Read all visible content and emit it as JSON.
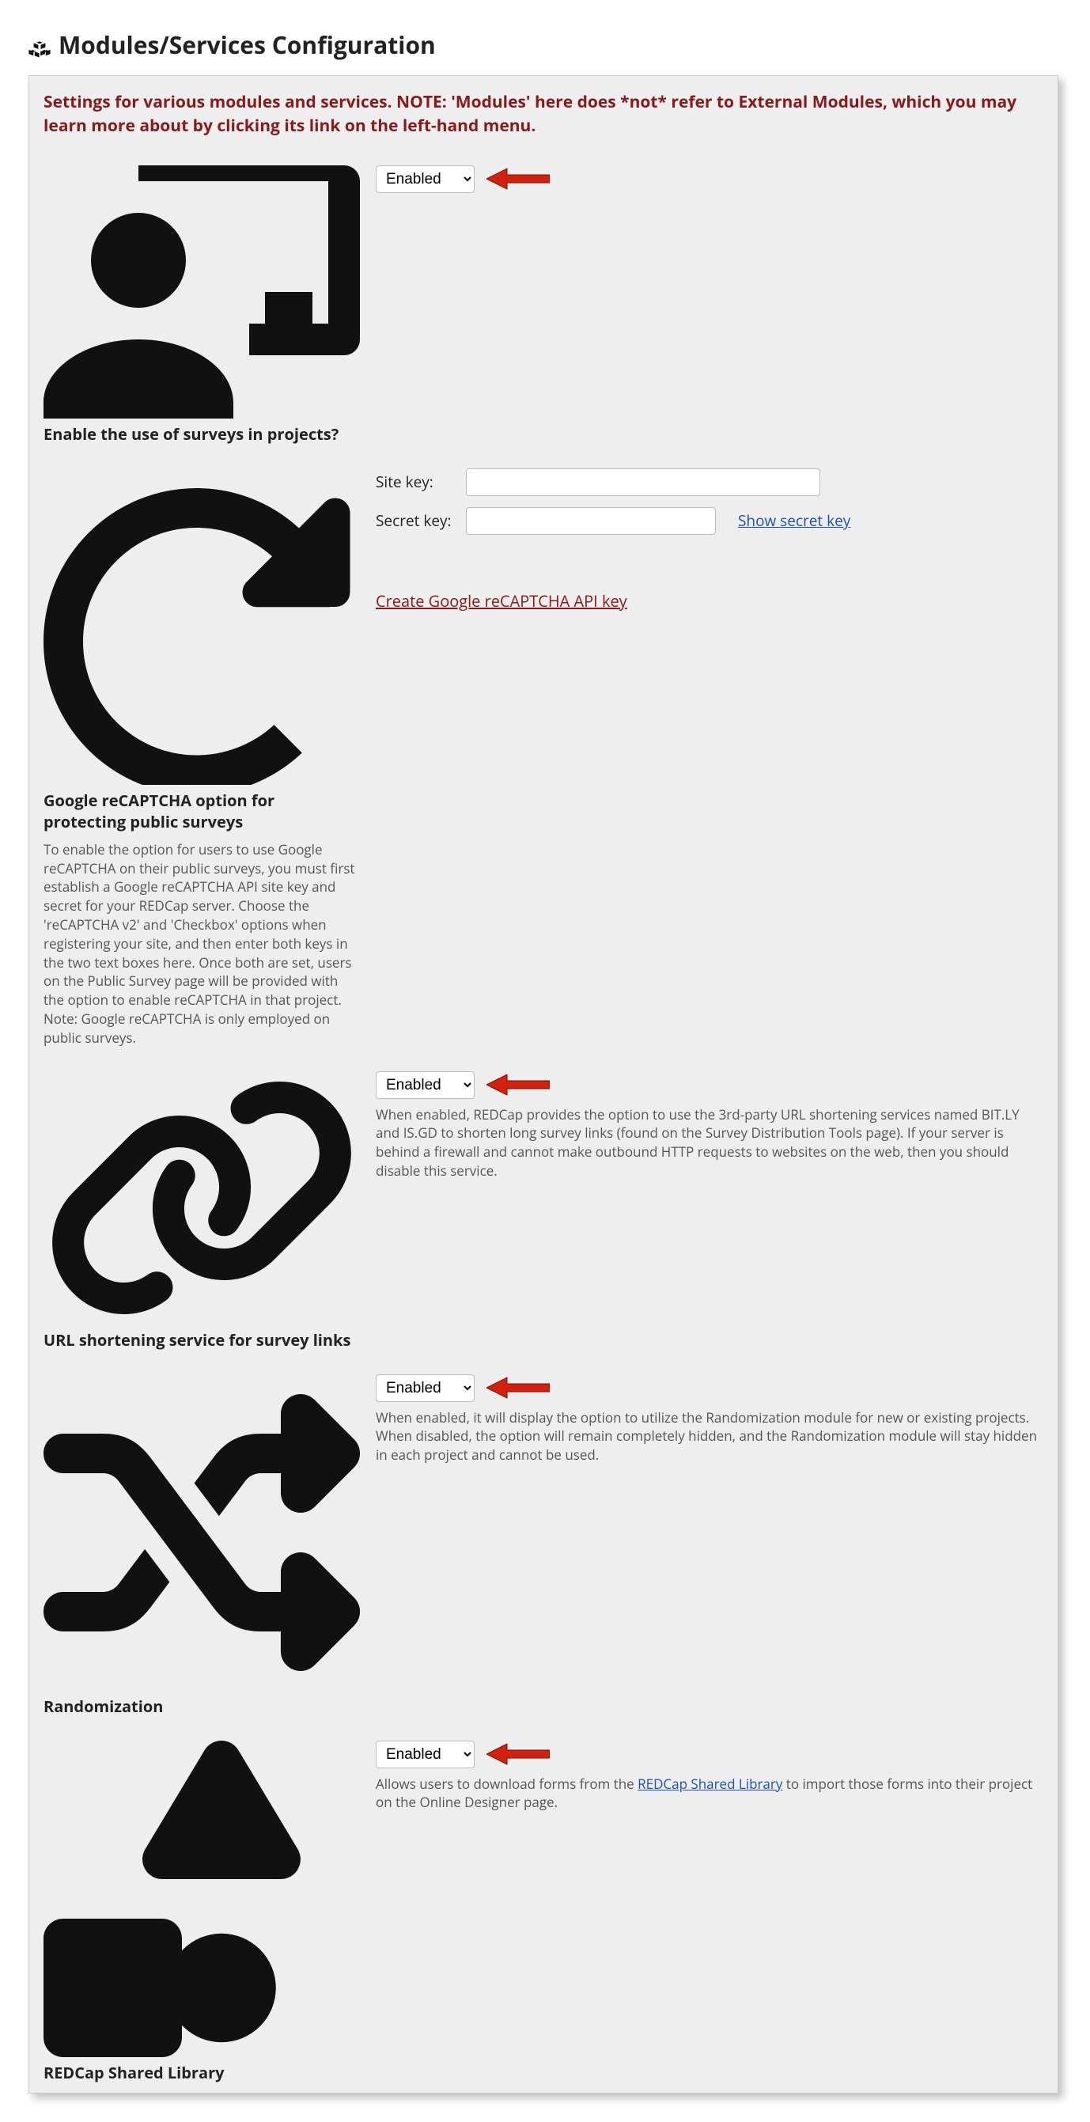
{
  "page": {
    "title": "Modules/Services Configuration",
    "notice": "Settings for various modules and services. NOTE: 'Modules' here does *not* refer to External Modules, which you may learn more about by clicking its link on the left-hand menu."
  },
  "rows": {
    "surveys": {
      "label": "Enable the use of surveys in projects?",
      "select": "Enabled"
    },
    "recaptcha": {
      "label": "Google reCAPTCHA option for protecting public surveys",
      "desc": "To enable the option for users to use Google reCAPTCHA on their public surveys, you must first establish a Google reCAPTCHA API site key and secret for your REDCap server. Choose the 'reCAPTCHA v2' and 'Checkbox' options when registering your site, and then enter both keys in the two text boxes here. Once both are set, users on the Public Survey page will be provided with the option to enable reCAPTCHA in that project. Note: Google reCAPTCHA is only employed on public surveys.",
      "site_key_label": "Site key:",
      "site_key_value": "",
      "secret_key_label": "Secret key:",
      "secret_key_value": "",
      "show_secret_link": "Show secret key",
      "create_api_link": "Create Google reCAPTCHA API key"
    },
    "url_shorten": {
      "label": "URL shortening service for survey links",
      "select": "Enabled",
      "help": "When enabled, REDCap provides the option to use the 3rd-party URL shortening services named BIT.LY and IS.GD to shorten long survey links (found on the Survey Distribution Tools page). If your server is behind a firewall and cannot make outbound HTTP requests to websites on the web, then you should disable this service."
    },
    "randomization": {
      "label": "Randomization",
      "select": "Enabled",
      "help": "When enabled, it will display the option to utilize the Randomization module for new or existing projects. When disabled, the option will remain completely hidden, and the Randomization module will stay hidden in each project and cannot be used."
    },
    "shared_lib": {
      "label": "REDCap Shared Library",
      "select": "Enabled",
      "help_prefix": "Allows users to download forms from the ",
      "help_link": "REDCap Shared Library",
      "help_suffix": " to import those forms into their project on the Online Designer page."
    }
  }
}
